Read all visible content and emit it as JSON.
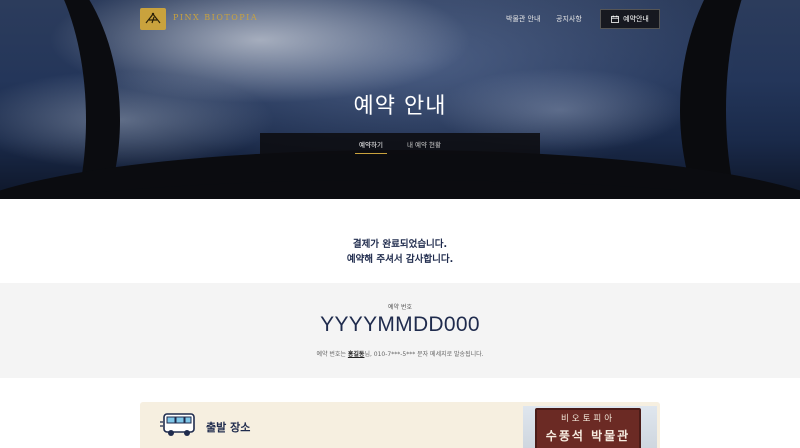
{
  "header": {
    "logo_text": "PINX BIOTOPIA",
    "nav": {
      "museum": "박물관 안내",
      "notice": "공지사항",
      "reserve": "예약안내"
    }
  },
  "hero": {
    "title": "예약 안내",
    "tabs": [
      {
        "label": "예약하기",
        "active": true
      },
      {
        "label": "내 예약 현황",
        "active": false
      }
    ]
  },
  "confirmation": {
    "line1": "결제가 완료되었습니다.",
    "line2": "예약해 주셔서 감사합니다."
  },
  "reservation": {
    "label": "예약 번호",
    "number": "YYYYMMDD000",
    "note_prefix": "예약 번호는 ",
    "name": "홍길동",
    "note_suffix": "님, 010-7***-5*** 문자 메세지로 발송됩니다."
  },
  "departure": {
    "title": "출발 장소",
    "photo_sign_top": "비오토피아",
    "photo_sign_main": "수풍석 박물관"
  },
  "colors": {
    "brand_gold": "#c9a23d",
    "navy_text": "#1f2b4d",
    "card_bg": "#f6efe0"
  }
}
